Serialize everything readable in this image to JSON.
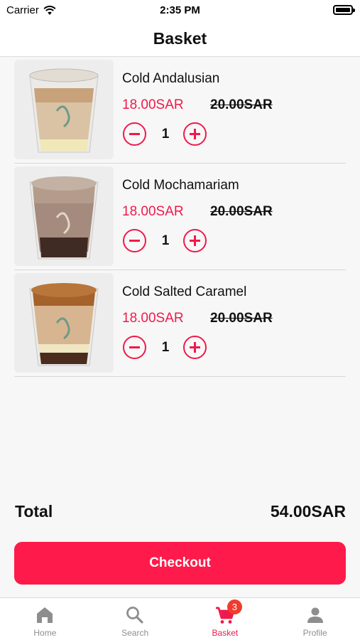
{
  "status_bar": {
    "carrier": "Carrier",
    "time": "2:35 PM"
  },
  "header": {
    "title": "Basket"
  },
  "items": [
    {
      "name": "Cold Andalusian",
      "price": "18.00SAR",
      "old_price": "20.00SAR",
      "quantity": "1"
    },
    {
      "name": "Cold Mochamariam",
      "price": "18.00SAR",
      "old_price": "20.00SAR",
      "quantity": "1"
    },
    {
      "name": "Cold Salted Caramel",
      "price": "18.00SAR",
      "old_price": "20.00SAR",
      "quantity": "1"
    }
  ],
  "total": {
    "label": "Total",
    "value": "54.00SAR"
  },
  "checkout": {
    "label": "Checkout"
  },
  "tabs": [
    {
      "label": "Home",
      "icon": "home-icon"
    },
    {
      "label": "Search",
      "icon": "search-icon"
    },
    {
      "label": "Basket",
      "icon": "cart-icon",
      "badge": "3",
      "active": true
    },
    {
      "label": "Profile",
      "icon": "profile-icon"
    }
  ],
  "colors": {
    "accent": "#f0194b",
    "button": "#fe1a4a",
    "badge": "#f03c2e",
    "inactive": "#8e8e8e"
  }
}
